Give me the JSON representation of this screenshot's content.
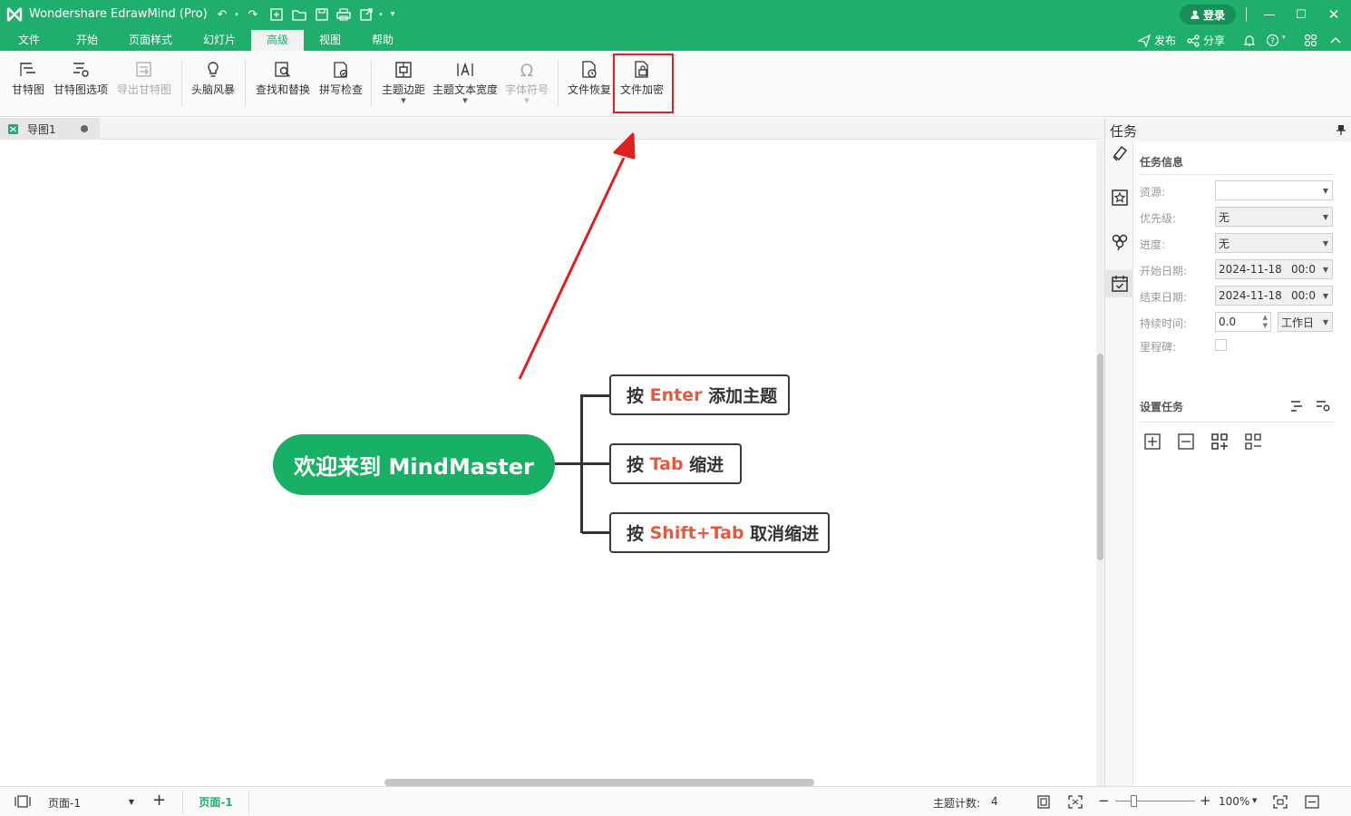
{
  "app": {
    "title": "Wondershare EdrawMind (Pro)",
    "login_label": "登录"
  },
  "menu": {
    "tabs": [
      "文件",
      "开始",
      "页面样式",
      "幻灯片",
      "高级",
      "视图",
      "帮助"
    ],
    "active_tab": "高级",
    "publish_label": "发布",
    "share_label": "分享"
  },
  "ribbon": {
    "gantt": "甘特图",
    "gantt_options": "甘特图选项",
    "export_gantt": "导出甘特图",
    "brainstorm": "头脑风暴",
    "find_replace": "查找和替换",
    "spell_check": "拼写检查",
    "topic_margin": "主题边距",
    "topic_text_width": "主题文本宽度",
    "font_symbol": "字体符号",
    "file_recovery": "文件恢复",
    "file_encrypt": "文件加密"
  },
  "document": {
    "tab_name": "导图1"
  },
  "mindmap": {
    "root": "欢迎来到 MindMaster",
    "topics": [
      {
        "prefix": "按 ",
        "key": "Enter",
        "suffix": " 添加主题"
      },
      {
        "prefix": "按 ",
        "key": "Tab",
        "suffix": " 缩进"
      },
      {
        "prefix": "按 ",
        "key": "Shift+Tab",
        "suffix": " 取消缩进"
      }
    ]
  },
  "task_panel": {
    "title": "任务",
    "info_title": "任务信息",
    "resource_label": "资源:",
    "resource_value": "",
    "priority_label": "优先级:",
    "priority_value": "无",
    "progress_label": "进度:",
    "progress_value": "无",
    "start_label": "开始日期:",
    "start_date": "2024-11-18",
    "start_time": "00:0",
    "end_label": "结束日期:",
    "end_date": "2024-11-18",
    "end_time": "00:0",
    "duration_label": "持续时间:",
    "duration_value": "0.0",
    "duration_unit": "工作日",
    "milestone_label": "里程碑:",
    "milestone_checked": false,
    "set_task_title": "设置任务"
  },
  "status": {
    "page_select": "页面-1",
    "active_page": "页面-1",
    "topic_count_label": "主题计数:",
    "topic_count": "4",
    "zoom": "100%"
  },
  "colors": {
    "brand": "#1fae6b",
    "root_topic": "#18b064",
    "key_text": "#e8583c",
    "annotation": "#e02020"
  }
}
